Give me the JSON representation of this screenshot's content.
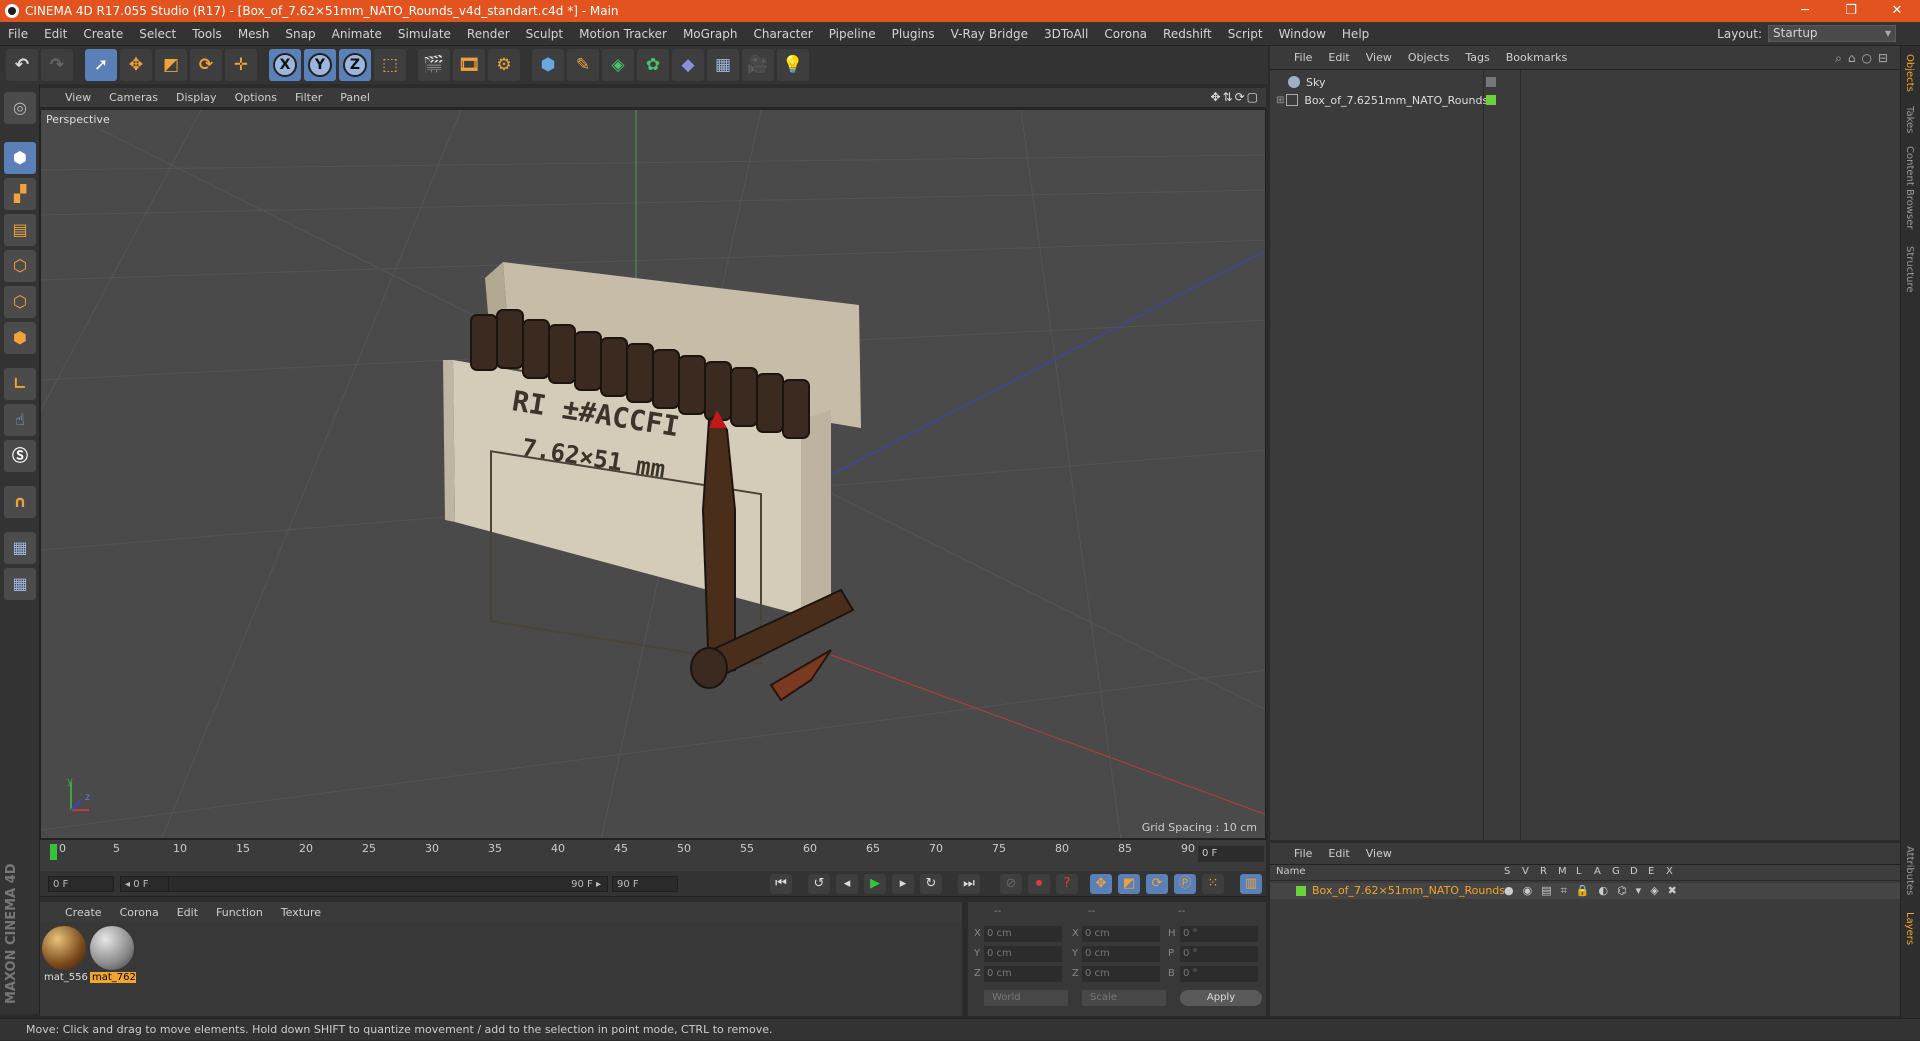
{
  "window": {
    "title": "CINEMA 4D R17.055 Studio (R17) - [Box_of_7.62×51mm_NATO_Rounds_v4d_standart.c4d *] - Main",
    "controls": [
      "─",
      "❐",
      "✕"
    ]
  },
  "menubar": {
    "items": [
      "File",
      "Edit",
      "Create",
      "Select",
      "Tools",
      "Mesh",
      "Snap",
      "Animate",
      "Simulate",
      "Render",
      "Sculpt",
      "Motion Tracker",
      "MoGraph",
      "Character",
      "Pipeline",
      "Plugins",
      "V-Ray Bridge",
      "3DToAll",
      "Corona",
      "Redshift",
      "Script",
      "Window",
      "Help"
    ],
    "layout_label": "Layout:",
    "layout_value": "Startup"
  },
  "toolbar": {
    "axis_x": "X",
    "axis_y": "Y",
    "axis_z": "Z"
  },
  "viewport": {
    "menu": [
      "View",
      "Cameras",
      "Display",
      "Options",
      "Filter",
      "Panel"
    ],
    "camera_label": "Perspective",
    "grid_spacing": "Grid Spacing : 10 cm",
    "axis_y": "y",
    "axis_z": "z",
    "colors": {
      "background": "#4a4a4a",
      "grid": "#555555",
      "x_axis": "#c23a3a",
      "y_axis": "#3fa34a",
      "z_axis": "#3a44c2"
    }
  },
  "timeline": {
    "ticks": [
      "0",
      "5",
      "10",
      "15",
      "20",
      "25",
      "30",
      "35",
      "40",
      "45",
      "50",
      "55",
      "60",
      "65",
      "70",
      "75",
      "80",
      "85",
      "90"
    ],
    "current_frame": "0 F"
  },
  "transport": {
    "start_field": "0 F",
    "range_start": "◂ 0 F",
    "range_end": "90 F ▸",
    "end_field": "90 F"
  },
  "material_manager": {
    "menu": [
      "Create",
      "Corona",
      "Edit",
      "Function",
      "Texture"
    ],
    "materials": [
      {
        "name": "mat_556",
        "selected": false
      },
      {
        "name": "mat_762",
        "selected": true
      }
    ]
  },
  "coordinates": {
    "headers": [
      "--",
      "--",
      "--"
    ],
    "rows": [
      {
        "a": "X",
        "a_val": "0 cm",
        "b": "X",
        "b_val": "0 cm",
        "c": "H",
        "c_val": "0 °"
      },
      {
        "a": "Y",
        "a_val": "0 cm",
        "b": "Y",
        "b_val": "0 cm",
        "c": "P",
        "c_val": "0 °"
      },
      {
        "a": "Z",
        "a_val": "0 cm",
        "b": "Z",
        "b_val": "0 cm",
        "c": "B",
        "c_val": "0 °"
      }
    ],
    "space": "World",
    "mode": "Scale",
    "apply": "Apply"
  },
  "object_manager": {
    "menu": [
      "File",
      "Edit",
      "View",
      "Objects",
      "Tags",
      "Bookmarks"
    ],
    "objects": [
      {
        "name": "Sky",
        "icon": "sky-icon"
      },
      {
        "name": "Box_of_7.6251mm_NATO_Rounds",
        "icon": "null-object-icon"
      }
    ]
  },
  "right_tabs": [
    "Objects",
    "Takes",
    "Content Browser",
    "Structure",
    "Attributes",
    "Layers"
  ],
  "layer_manager": {
    "menu": [
      "File",
      "Edit",
      "View"
    ],
    "columns": [
      "Name",
      "S",
      "V",
      "R",
      "M",
      "L",
      "A",
      "G",
      "D",
      "E",
      "X"
    ],
    "row_name": "Box_of_7.62×51mm_NATO_Rounds"
  },
  "status": {
    "text": "Move: Click and drag to move elements. Hold down SHIFT to quantize movement / add to the selection in point mode, CTRL to remove."
  },
  "branding": {
    "logo_text": "MAXON CINEMA 4D"
  }
}
